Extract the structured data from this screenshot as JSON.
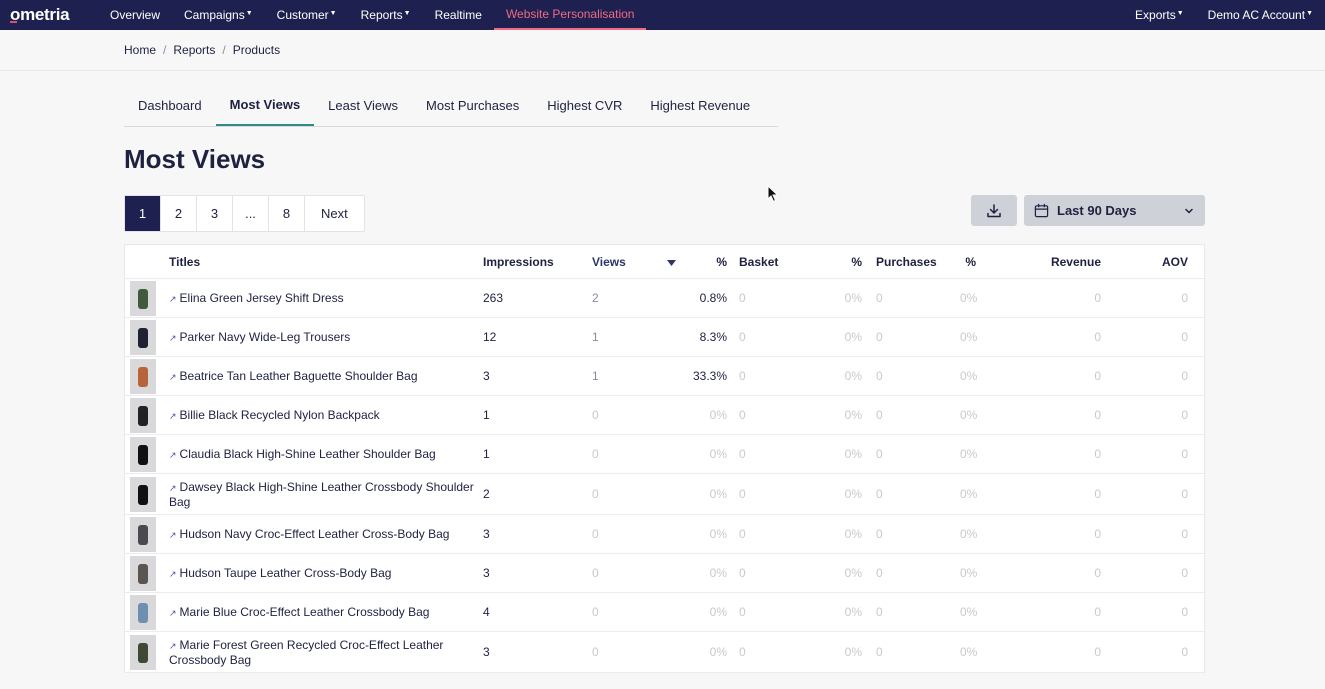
{
  "brand": "ometria",
  "nav": {
    "items": [
      {
        "label": "Overview",
        "caret": false,
        "active": false
      },
      {
        "label": "Campaigns",
        "caret": true,
        "active": false
      },
      {
        "label": "Customer",
        "caret": true,
        "active": false
      },
      {
        "label": "Reports",
        "caret": true,
        "active": false
      },
      {
        "label": "Realtime",
        "caret": false,
        "active": false
      },
      {
        "label": "Website Personalisation",
        "caret": false,
        "active": true
      }
    ],
    "right": [
      {
        "label": "Exports",
        "caret": true
      },
      {
        "label": "Demo AC Account",
        "caret": true
      }
    ]
  },
  "breadcrumb": [
    "Home",
    "Reports",
    "Products"
  ],
  "tabs": [
    {
      "label": "Dashboard",
      "active": false
    },
    {
      "label": "Most Views",
      "active": true
    },
    {
      "label": "Least Views",
      "active": false
    },
    {
      "label": "Most Purchases",
      "active": false
    },
    {
      "label": "Highest CVR",
      "active": false
    },
    {
      "label": "Highest Revenue",
      "active": false
    }
  ],
  "page_title": "Most Views",
  "pagination": [
    "1",
    "2",
    "3",
    "...",
    "8",
    "Next"
  ],
  "date_range": "Last 90 Days",
  "table": {
    "headers": {
      "titles": "Titles",
      "impressions": "Impressions",
      "views": "Views",
      "views_pct": "%",
      "basket": "Basket",
      "basket_pct": "%",
      "purchases": "Purchases",
      "purchases_pct": "%",
      "revenue": "Revenue",
      "aov": "AOV"
    },
    "rows": [
      {
        "title": "Elina Green Jersey Shift Dress",
        "impressions": "263",
        "views": "2",
        "views_pct": "0.8%",
        "basket": "0",
        "basket_pct": "0%",
        "purchases": "0",
        "purchases_pct": "0%",
        "revenue": "0",
        "aov": "0",
        "thumb_color": "#3f5a3c"
      },
      {
        "title": "Parker Navy Wide-Leg Trousers",
        "impressions": "12",
        "views": "1",
        "views_pct": "8.3%",
        "basket": "0",
        "basket_pct": "0%",
        "purchases": "0",
        "purchases_pct": "0%",
        "revenue": "0",
        "aov": "0",
        "thumb_color": "#1f2233"
      },
      {
        "title": "Beatrice Tan Leather Baguette Shoulder Bag",
        "impressions": "3",
        "views": "1",
        "views_pct": "33.3%",
        "basket": "0",
        "basket_pct": "0%",
        "purchases": "0",
        "purchases_pct": "0%",
        "revenue": "0",
        "aov": "0",
        "thumb_color": "#b8643a"
      },
      {
        "title": "Billie Black Recycled Nylon Backpack",
        "impressions": "1",
        "views": "0",
        "views_pct": "0%",
        "basket": "0",
        "basket_pct": "0%",
        "purchases": "0",
        "purchases_pct": "0%",
        "revenue": "0",
        "aov": "0",
        "thumb_color": "#222222"
      },
      {
        "title": "Claudia Black High-Shine Leather Shoulder Bag",
        "impressions": "1",
        "views": "0",
        "views_pct": "0%",
        "basket": "0",
        "basket_pct": "0%",
        "purchases": "0",
        "purchases_pct": "0%",
        "revenue": "0",
        "aov": "0",
        "thumb_color": "#111111"
      },
      {
        "title": "Dawsey Black High-Shine Leather Crossbody Shoulder Bag",
        "impressions": "2",
        "views": "0",
        "views_pct": "0%",
        "basket": "0",
        "basket_pct": "0%",
        "purchases": "0",
        "purchases_pct": "0%",
        "revenue": "0",
        "aov": "0",
        "thumb_color": "#111111"
      },
      {
        "title": "Hudson Navy Croc-Effect Leather Cross-Body Bag",
        "impressions": "3",
        "views": "0",
        "views_pct": "0%",
        "basket": "0",
        "basket_pct": "0%",
        "purchases": "0",
        "purchases_pct": "0%",
        "revenue": "0",
        "aov": "0",
        "thumb_color": "#4a4a52"
      },
      {
        "title": "Hudson Taupe Leather Cross-Body Bag",
        "impressions": "3",
        "views": "0",
        "views_pct": "0%",
        "basket": "0",
        "basket_pct": "0%",
        "purchases": "0",
        "purchases_pct": "0%",
        "revenue": "0",
        "aov": "0",
        "thumb_color": "#5a5550"
      },
      {
        "title": "Marie Blue Croc-Effect Leather Crossbody Bag",
        "impressions": "4",
        "views": "0",
        "views_pct": "0%",
        "basket": "0",
        "basket_pct": "0%",
        "purchases": "0",
        "purchases_pct": "0%",
        "revenue": "0",
        "aov": "0",
        "thumb_color": "#6f8fb0"
      },
      {
        "title": "Marie Forest Green Recycled Croc-Effect Leather Crossbody Bag",
        "impressions": "3",
        "views": "0",
        "views_pct": "0%",
        "basket": "0",
        "basket_pct": "0%",
        "purchases": "0",
        "purchases_pct": "0%",
        "revenue": "0",
        "aov": "0",
        "thumb_color": "#3e4a36"
      }
    ]
  },
  "colors": {
    "nav_bg": "#1e2150",
    "accent_pink": "#ef6a86",
    "tab_underline": "#2f8b86",
    "muted_text": "#c8c9cf"
  }
}
